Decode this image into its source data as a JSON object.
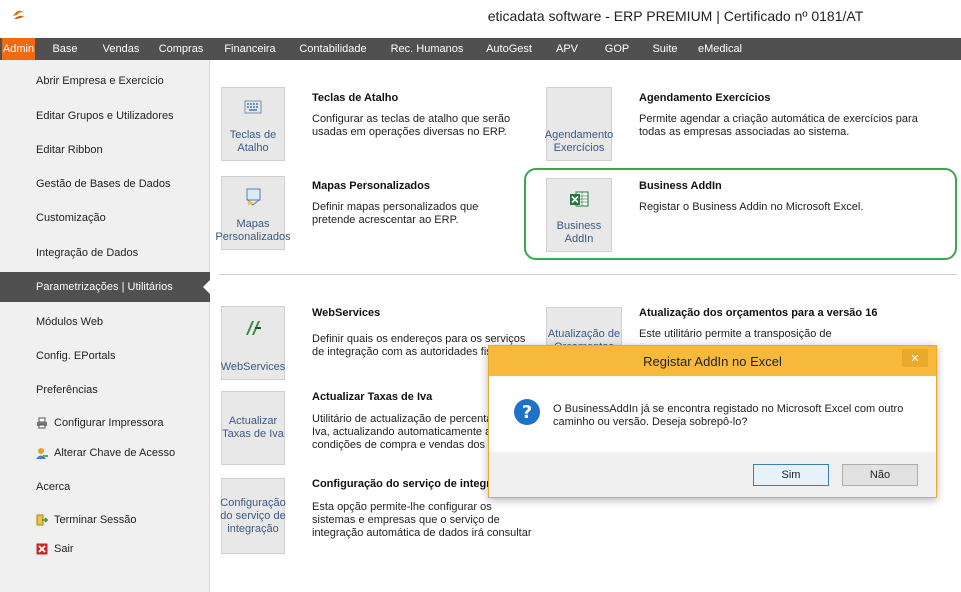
{
  "window": {
    "title": "eticadata software - ERP PREMIUM | Certificado nº 0181/AT"
  },
  "menu": {
    "tabs": [
      {
        "label": "Admin",
        "active": true
      },
      {
        "label": "Base"
      },
      {
        "label": "Vendas"
      },
      {
        "label": "Compras"
      },
      {
        "label": "Financeira"
      },
      {
        "label": "Contabilidade"
      },
      {
        "label": "Rec. Humanos"
      },
      {
        "label": "AutoGest"
      },
      {
        "label": "APV"
      },
      {
        "label": "GOP"
      },
      {
        "label": "Suite"
      },
      {
        "label": "eMedical"
      }
    ]
  },
  "sidebar": {
    "items": [
      {
        "label": "Abrir Empresa e Exercício"
      },
      {
        "label": "Editar Grupos e Utilizadores"
      },
      {
        "label": "Editar Ribbon"
      },
      {
        "label": "Gestão de Bases de Dados"
      },
      {
        "label": "Customização"
      },
      {
        "label": "Integração de Dados"
      },
      {
        "label": "Parametrizações | Utilitários",
        "active": true
      },
      {
        "label": "Módulos Web"
      },
      {
        "label": "Config. EPortals"
      },
      {
        "label": "Preferências"
      },
      {
        "label": "Configurar Impressora",
        "icon": "printer-icon"
      },
      {
        "label": "Alterar Chave de Acesso",
        "icon": "user-key-icon"
      },
      {
        "label": "Acerca"
      },
      {
        "label": "Terminar Sessão",
        "icon": "logout-icon"
      },
      {
        "label": "Sair",
        "icon": "exit-icon"
      }
    ]
  },
  "main": {
    "items": [
      {
        "tile": "Teclas de\nAtalho",
        "title": "Teclas de Atalho",
        "desc": "Configurar as teclas de atalho que serão usadas em operações diversas no ERP.",
        "icon": "keyboard-icon"
      },
      {
        "tile": "Agendamento\nExercícios",
        "title": "Agendamento Exercícios",
        "desc": "Permite agendar a criação automática de exercícios para todas as empresas associadas ao sistema."
      },
      {
        "tile": "Mapas\nPersonalizados",
        "title": "Mapas Personalizados",
        "desc": "Definir mapas personalizados que pretende acrescentar ao ERP.",
        "icon": "map-icon"
      },
      {
        "tile": "Business\nAddIn",
        "title": "Business AddIn",
        "desc": "Registar o Business Addin no Microsoft Excel.",
        "icon": "excel-icon"
      },
      {
        "tile": "WebServices",
        "title": "WebServices",
        "desc": "Definir quais os endereços para os serviços de integração com as autoridades fiscais",
        "icon": "webservices-icon"
      },
      {
        "tile": "Atualização de\nOrçamentos",
        "title": "Atualização dos orçamentos para a versão 16",
        "desc": "Este utilitário permite a transposição de"
      },
      {
        "tile": "Actualizar\nTaxas de Iva",
        "title": "Actualizar Taxas de Iva",
        "desc": "Utilitário de actualização de percenta\nIva, actualizando automaticamente a\ncondições de compra e vendas dos a"
      },
      {
        "tile": "Configuração\ndo serviço de\nintegração",
        "title": "Configuração do serviço de integr",
        "desc": "Esta opção permite-lhe configurar os\nsistemas e empresas que o serviço de\nintegração automática de dados irá consultar"
      }
    ]
  },
  "dialog": {
    "title": "Registar AddIn no Excel",
    "message": "O BusinessAddIn já se encontra registado no Microsoft Excel com outro caminho ou versão. Deseja sobrepô-lo?",
    "yes_label": "Sim",
    "no_label": "Não",
    "close_glyph": "✕",
    "question_glyph": "?"
  }
}
